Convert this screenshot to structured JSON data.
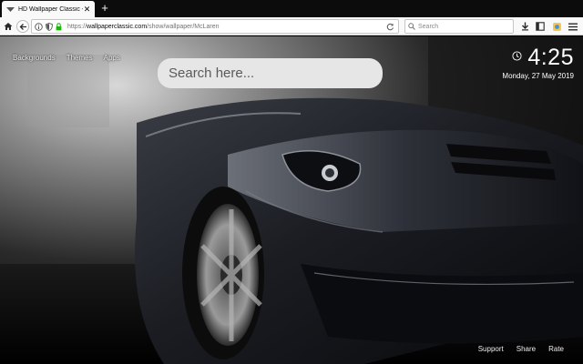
{
  "browser": {
    "tab": {
      "title": "HD Wallpaper Classic - McLaren",
      "close": "✕"
    },
    "new_tab": "+",
    "url": {
      "scheme": "https://",
      "host": "wallpaperclassic.com",
      "path": "/show/wallpaper/McLaren"
    },
    "search_placeholder": "Search"
  },
  "page": {
    "top_links": [
      {
        "label": "Backgrounds"
      },
      {
        "label": "Themes"
      },
      {
        "label": "Apps"
      }
    ],
    "search": {
      "placeholder": "Search here..."
    },
    "clock": {
      "time": "4:25",
      "date": "Monday, 27 May 2019"
    },
    "footer_links": [
      {
        "label": "Support"
      },
      {
        "label": "Share"
      },
      {
        "label": "Rate"
      }
    ]
  },
  "colors": {
    "chrome_dark": "#0c0c0d",
    "chrome_light": "#f9f9fa",
    "secure_green": "#12bc00",
    "search_box": "#e6e6e6"
  },
  "icons": [
    "favicon-icon",
    "back-arrow-icon",
    "info-icon",
    "shield-icon",
    "lock-icon",
    "reload-icon",
    "search-icon",
    "download-icon",
    "library-icon",
    "extension-icon",
    "menu-icon",
    "home-icon",
    "alarm-icon"
  ]
}
